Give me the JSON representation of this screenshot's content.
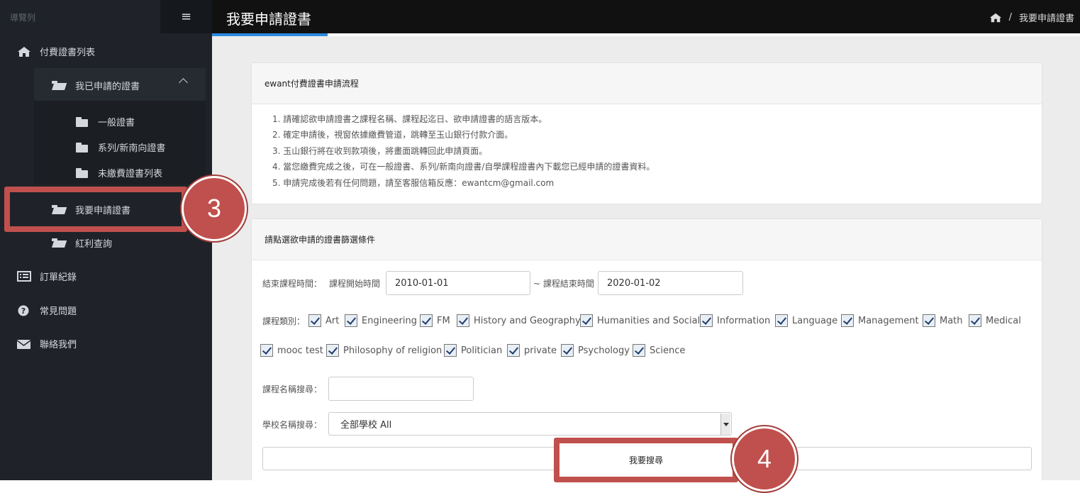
{
  "sidebar": {
    "title": "導覽列",
    "menu_icon": "hamburger-icon",
    "items": [
      {
        "label": "付費證書列表",
        "icon": "home-icon"
      },
      {
        "label": "我已申請的證書",
        "icon": "folder-open-icon"
      },
      {
        "label": "一般證書",
        "icon": "folder-icon"
      },
      {
        "label": "系列/新南向證書",
        "icon": "folder-icon"
      },
      {
        "label": "未繳費證書列表",
        "icon": "folder-icon"
      },
      {
        "label": "我要申請證書",
        "icon": "folder-open-icon"
      },
      {
        "label": "紅利查詢",
        "icon": "folder-open-icon"
      },
      {
        "label": "訂單紀錄",
        "icon": "list-icon"
      },
      {
        "label": "常見問題",
        "icon": "question-icon"
      },
      {
        "label": "聯絡我們",
        "icon": "envelope-icon"
      }
    ]
  },
  "header": {
    "title": "我要申請證書",
    "breadcrumb": {
      "separator": "/",
      "current": "我要申請證書"
    }
  },
  "process_panel": {
    "title": "ewant付費證書申請流程",
    "steps": [
      "1. 請確認欲申請證書之課程名稱、課程起迄日、欲申請證書的語言版本。",
      "2. 確定申請後，視窗依據繳費管道，跳轉至玉山銀行付款介面。",
      "3. 玉山銀行將在收到款項後，將畫面跳轉回此申請頁面。",
      "4. 當您繳費完成之後，可在一般證書、系列/新南向證書/自學課程證書內下載您已經申請的證書資料。",
      "5. 申請完成後若有任何問題，請至客服信箱反應：ewantcm@gmail.com"
    ]
  },
  "filter_panel": {
    "title": "請點選欲申請的證書篩選條件",
    "end_time_label": "結束課程時間：",
    "start_label": "課程開始時間",
    "start_value": "2010-01-01",
    "end_label": "~ 課程結束時間",
    "end_value": "2020-01-02",
    "category_label": "課程類別：",
    "categories_row1": [
      "Art",
      "Engineering",
      "FM",
      "History and Geography",
      "Humanities and Social",
      "Information",
      "Language",
      "Management",
      "Math",
      "Medical"
    ],
    "categories_row2": [
      "mooc test",
      "Philosophy of religion",
      "Politician",
      "private",
      "Psychology",
      "Science"
    ],
    "course_search_label": "課程名稱搜尋：",
    "course_search_value": "",
    "school_search_label": "學校名稱搜尋：",
    "school_selected": "全部學校 All",
    "search_button": "我要搜尋"
  },
  "annotations": {
    "badge_3": "3",
    "badge_4": "4",
    "color": "#c0504d"
  }
}
